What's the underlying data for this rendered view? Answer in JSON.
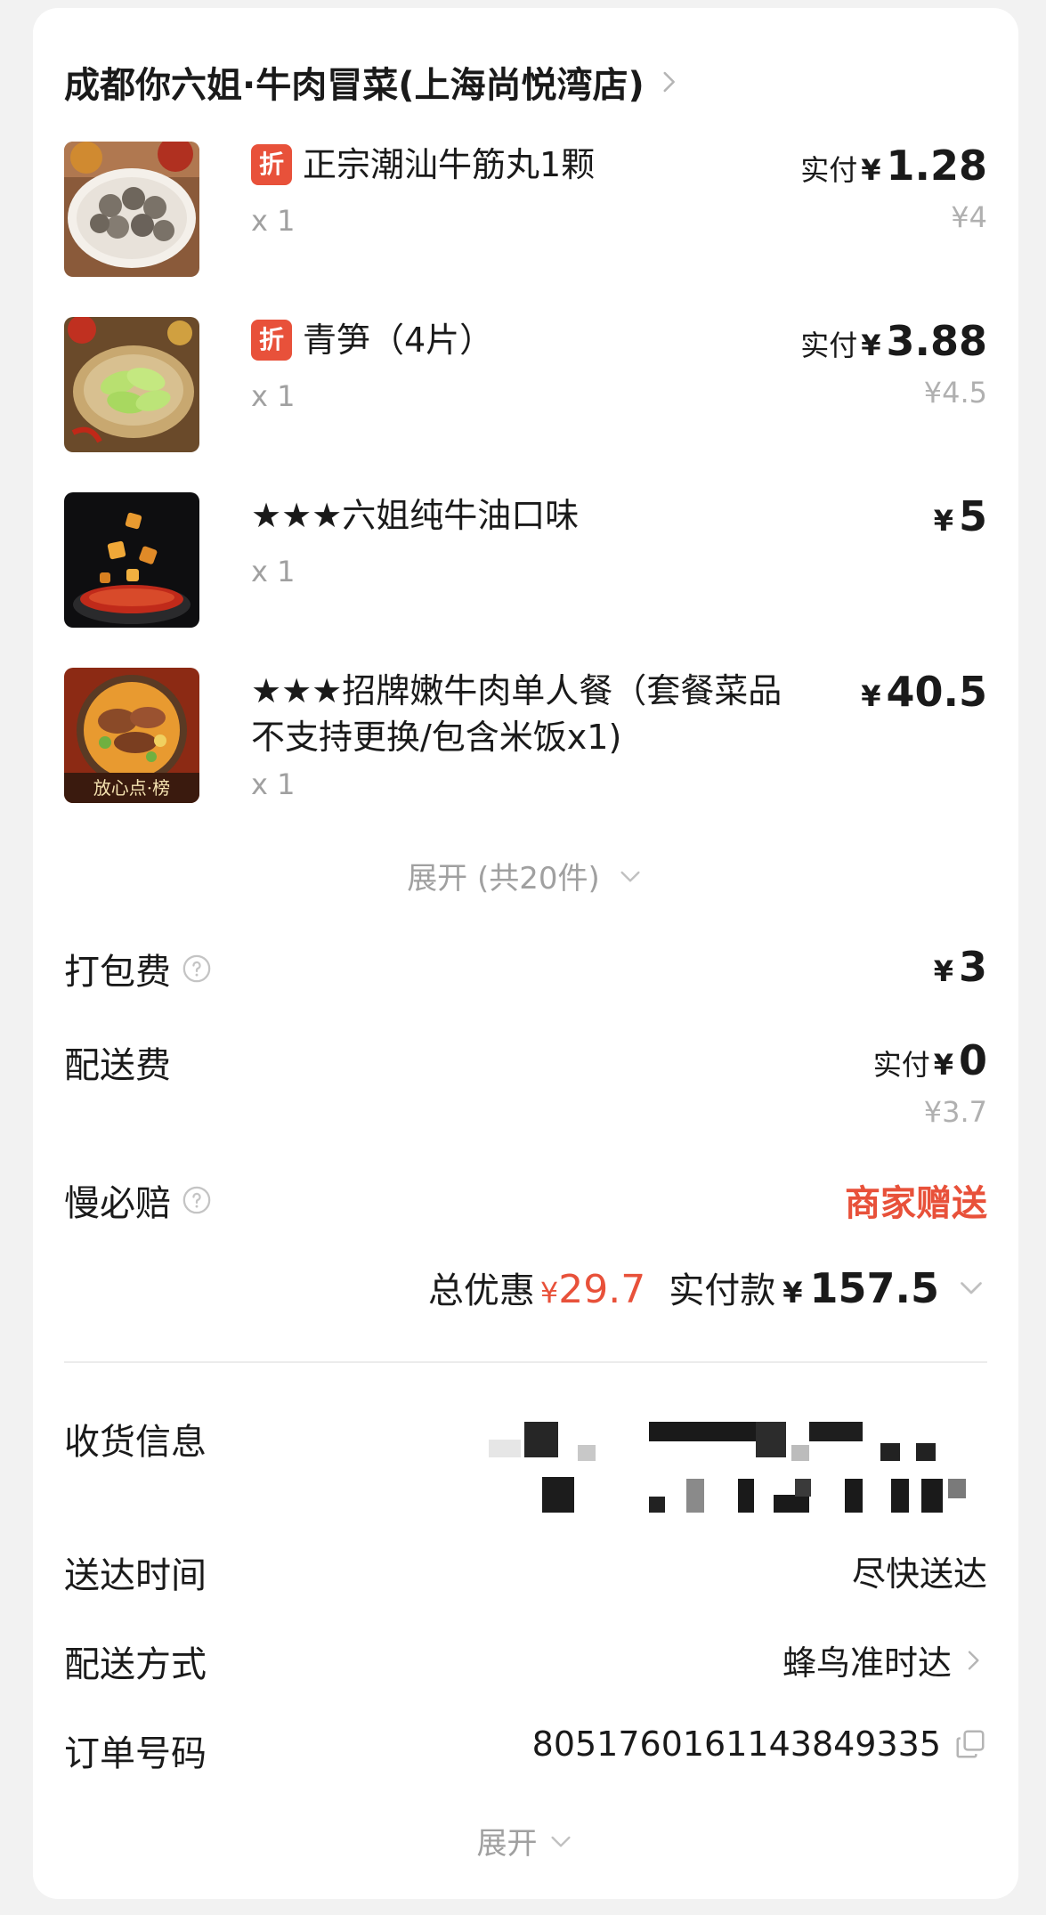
{
  "store": {
    "name": "成都你六姐·牛肉冒菜(上海尚悦湾店)"
  },
  "items": [
    {
      "badge": "折",
      "name": "正宗潮汕牛筋丸1颗",
      "qty": "x 1",
      "paid_label": "实付",
      "currency": "¥",
      "price": "1.28",
      "original_price": "¥4",
      "image": "beef-ball-photo"
    },
    {
      "badge": "折",
      "name": "青笋（4片）",
      "qty": "x 1",
      "paid_label": "实付",
      "currency": "¥",
      "price": "3.88",
      "original_price": "¥4.5",
      "image": "lettuce-stem-photo"
    },
    {
      "name": "★★★六姐纯牛油口味",
      "qty": "x 1",
      "currency": "¥",
      "price": "5",
      "image": "beef-tallow-broth-photo"
    },
    {
      "name": "★★★招牌嫩牛肉单人餐（套餐菜品不支持更换/包含米饭x1)",
      "qty": "x 1",
      "currency": "¥",
      "price": "40.5",
      "image": "beef-set-meal-photo",
      "image_caption": "放心点·榜"
    }
  ],
  "expand_items": {
    "label": "展开 (共20件)"
  },
  "fees": {
    "packing": {
      "label": "打包费",
      "currency": "¥",
      "amount": "3"
    },
    "delivery": {
      "label": "配送费",
      "paid_label": "实付",
      "currency": "¥",
      "amount": "0",
      "original": "¥3.7"
    },
    "late_compensation": {
      "label": "慢必赔",
      "value": "商家赠送"
    }
  },
  "summary": {
    "discount_label": "总优惠",
    "discount_currency": "¥",
    "discount_amount": "29.7",
    "total_label": "实付款",
    "total_currency": "¥",
    "total_amount": "157.5"
  },
  "info": {
    "address_label": "收货信息",
    "delivery_time_label": "送达时间",
    "delivery_time_value": "尽快送达",
    "delivery_method_label": "配送方式",
    "delivery_method_value": "蜂鸟准时达",
    "order_no_label": "订单号码",
    "order_no_value": "8051760161143849335"
  },
  "bottom_expand": {
    "label": "展开"
  },
  "colors": {
    "accent_red": "#e8513a",
    "muted_text": "#a0a0a0",
    "card_bg": "#ffffff",
    "page_bg": "#f2f2f2"
  }
}
